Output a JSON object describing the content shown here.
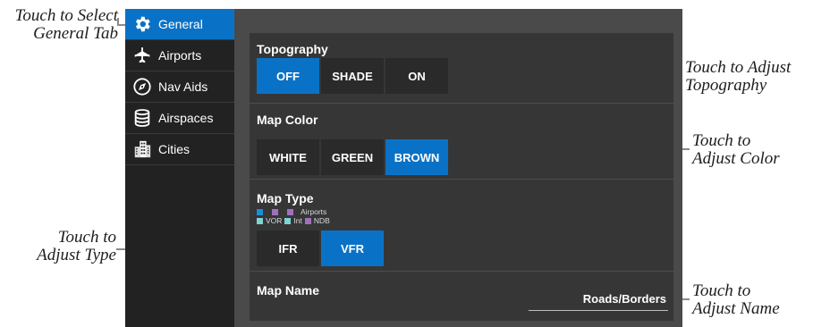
{
  "callouts": {
    "general_tab": [
      "Touch to Select",
      "General Tab"
    ],
    "adjust_type": [
      "Touch to",
      "Adjust Type"
    ],
    "adjust_topography": [
      "Touch to Adjust",
      "Topography"
    ],
    "adjust_color": [
      "Touch to",
      "Adjust Color"
    ],
    "adjust_name": [
      "Touch to",
      "Adjust Name"
    ]
  },
  "sidebar": {
    "items": [
      {
        "label": "General",
        "icon": "gear-icon",
        "active": true
      },
      {
        "label": "Airports",
        "icon": "airport-icon",
        "active": false
      },
      {
        "label": "Nav Aids",
        "icon": "compass-icon",
        "active": false
      },
      {
        "label": "Airspaces",
        "icon": "database-icon",
        "active": false
      },
      {
        "label": "Cities",
        "icon": "city-icon",
        "active": false
      }
    ]
  },
  "topography": {
    "title": "Topography",
    "options": [
      "OFF",
      "SHADE",
      "ON"
    ],
    "selected": "OFF"
  },
  "map_color": {
    "title": "Map Color",
    "options": [
      "WHITE",
      "GREEN",
      "BROWN"
    ],
    "selected": "BROWN"
  },
  "map_type": {
    "title": "Map Type",
    "legend_row1_label": "Airports",
    "legend_row2": [
      "VOR",
      "Int",
      "NDB"
    ],
    "options": [
      "IFR",
      "VFR"
    ],
    "selected": "VFR"
  },
  "map_name": {
    "title": "Map Name",
    "value": "Roads/Borders"
  },
  "colors": {
    "accent": "#0a72c6",
    "legend_blue": "#1a8fd6",
    "legend_purple": "#a070c0",
    "legend_cyan": "#7fd4d4"
  }
}
